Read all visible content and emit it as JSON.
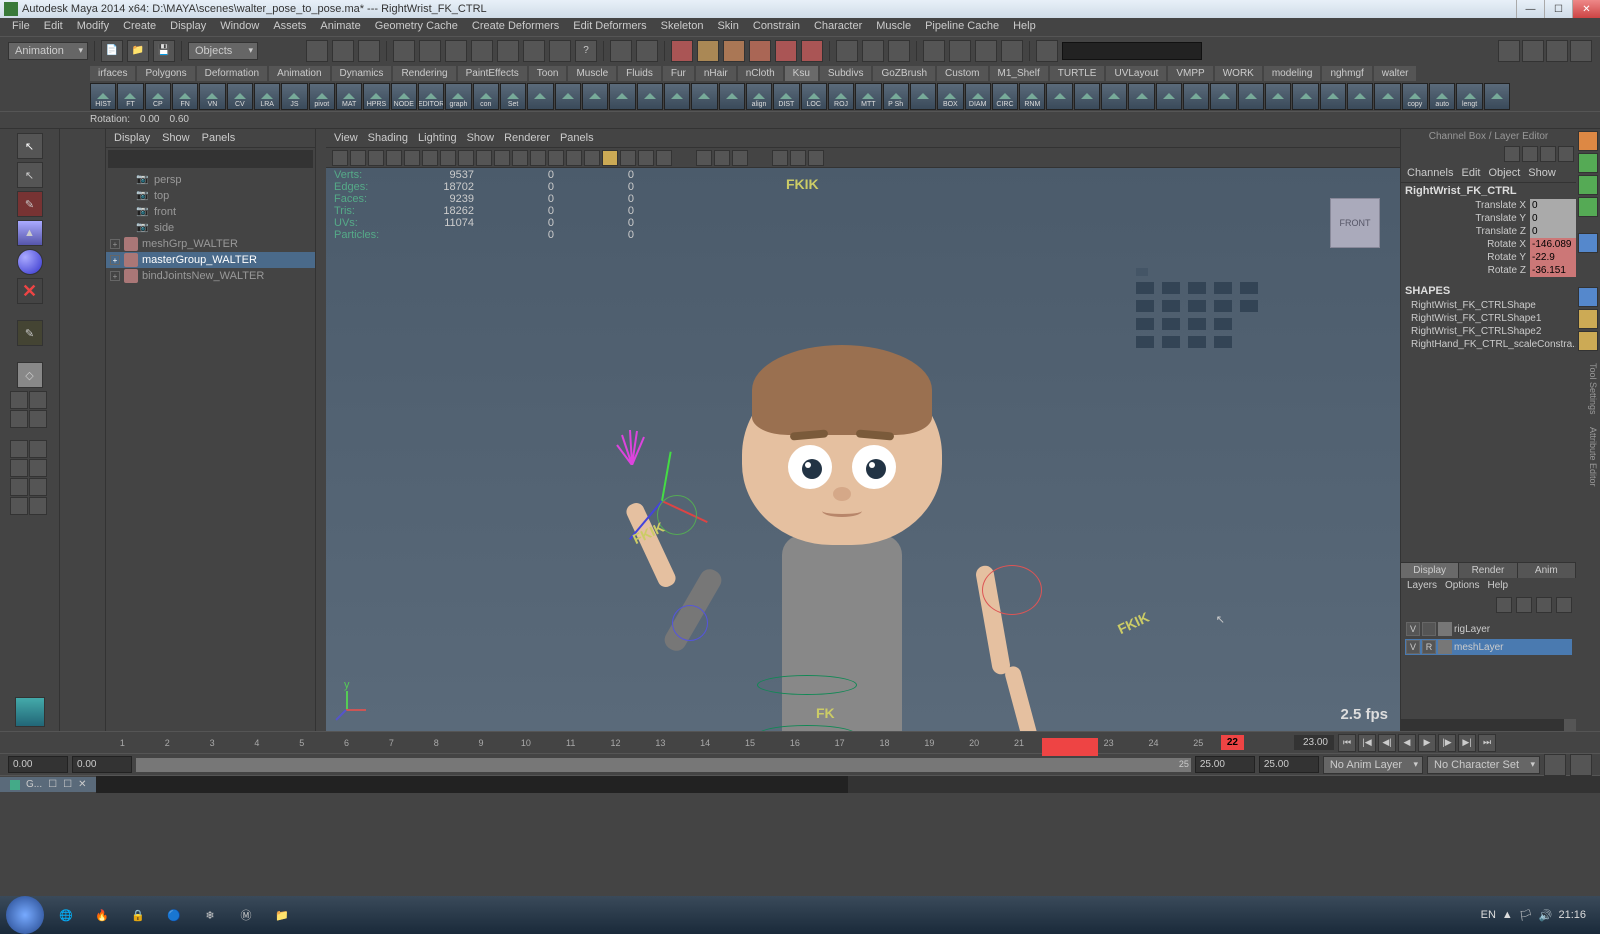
{
  "title": "Autodesk Maya 2014 x64: D:\\MAYA\\scenes\\walter_pose_to_pose.ma*  ---  RightWrist_FK_CTRL",
  "menubar": [
    "File",
    "Edit",
    "Modify",
    "Create",
    "Display",
    "Window",
    "Assets",
    "Animate",
    "Geometry Cache",
    "Create Deformers",
    "Edit Deformers",
    "Skeleton",
    "Skin",
    "Constrain",
    "Character",
    "Muscle",
    "Pipeline Cache",
    "Help"
  ],
  "mode_dropdown": "Animation",
  "objects_search": "Objects",
  "shelf_tabs": [
    "irfaces",
    "Polygons",
    "Deformation",
    "Animation",
    "Dynamics",
    "Rendering",
    "PaintEffects",
    "Toon",
    "Muscle",
    "Fluids",
    "Fur",
    "nHair",
    "nCloth",
    "Ksu",
    "Subdivs",
    "GoZBrush",
    "Custom",
    "M1_Shelf",
    "TURTLE",
    "UVLayout",
    "VMPP",
    "WORK",
    "modeling",
    "nghmgf",
    "walter"
  ],
  "shelf_active": "Ksu",
  "shelf_labels": [
    "HIST",
    "FT",
    "CP",
    "FN",
    "VN",
    "CV",
    "LRA",
    "JS",
    "pivot",
    "MAT",
    "HPRS",
    "NODE",
    "EDITOR",
    "graph",
    "con",
    "Set",
    "",
    "",
    "",
    "",
    "",
    "",
    "",
    "",
    "align",
    "DIST",
    "LOC",
    "ROJ",
    "MTT",
    "P Sh",
    "",
    "BOX",
    "DIAM",
    "CIRC",
    "RNM",
    "",
    "",
    "",
    "",
    "",
    "",
    "",
    "",
    "",
    "",
    "",
    "",
    "",
    "copy",
    "auto",
    "lengt",
    ""
  ],
  "status_line": {
    "label": "Rotation:",
    "v1": "0.00",
    "v2": "0.60"
  },
  "outliner": {
    "menu": [
      "Display",
      "Show",
      "Panels"
    ],
    "items": [
      {
        "type": "cam",
        "name": "persp"
      },
      {
        "type": "cam",
        "name": "top"
      },
      {
        "type": "cam",
        "name": "front"
      },
      {
        "type": "cam",
        "name": "side"
      },
      {
        "type": "grp",
        "name": "meshGrp_WALTER",
        "exp": true
      },
      {
        "type": "grp",
        "name": "masterGroup_WALTER",
        "exp": true,
        "sel": true
      },
      {
        "type": "grp",
        "name": "bindJointsNew_WALTER",
        "exp": true
      }
    ]
  },
  "viewport": {
    "menu": [
      "View",
      "Shading",
      "Lighting",
      "Show",
      "Renderer",
      "Panels"
    ],
    "stats": [
      {
        "label": "Verts:",
        "a": "9537",
        "b": "0",
        "c": "0"
      },
      {
        "label": "Edges:",
        "a": "18702",
        "b": "0",
        "c": "0"
      },
      {
        "label": "Faces:",
        "a": "9239",
        "b": "0",
        "c": "0"
      },
      {
        "label": "Tris:",
        "a": "18262",
        "b": "0",
        "c": "0"
      },
      {
        "label": "UVs:",
        "a": "11074",
        "b": "0",
        "c": "0"
      },
      {
        "label": "Particles:",
        "a": "",
        "b": "0",
        "c": "0"
      }
    ],
    "fps": "2.5 fps",
    "viewcube": "FRONT",
    "fk_label": "FK",
    "fkik_top": "FKIK",
    "fkik_right": "FKIK"
  },
  "channel_box": {
    "title": "Channel Box / Layer Editor",
    "menu": [
      "Channels",
      "Edit",
      "Object",
      "Show"
    ],
    "object": "RightWrist_FK_CTRL",
    "attrs": [
      {
        "name": "Translate X",
        "val": "0",
        "hl": "gray"
      },
      {
        "name": "Translate Y",
        "val": "0",
        "hl": "gray"
      },
      {
        "name": "Translate Z",
        "val": "0",
        "hl": "gray"
      },
      {
        "name": "Rotate X",
        "val": "-146.089",
        "hl": "red"
      },
      {
        "name": "Rotate Y",
        "val": "-22.9",
        "hl": "red"
      },
      {
        "name": "Rotate Z",
        "val": "-36.151",
        "hl": "red"
      }
    ],
    "shapes_header": "SHAPES",
    "shapes": [
      "RightWrist_FK_CTRLShape",
      "RightWrist_FK_CTRLShape1",
      "RightWrist_FK_CTRLShape2",
      "RightHand_FK_CTRL_scaleConstra..."
    ],
    "tabs": [
      "Display",
      "Render",
      "Anim"
    ],
    "tab_active": "Display",
    "submenu": [
      "Layers",
      "Options",
      "Help"
    ],
    "layers": [
      {
        "v": "V",
        "r": "",
        "name": "rigLayer",
        "sel": false
      },
      {
        "v": "V",
        "r": "R",
        "name": "meshLayer",
        "sel": true
      }
    ]
  },
  "timeline": {
    "ticks": [
      "1",
      "2",
      "3",
      "4",
      "5",
      "6",
      "7",
      "8",
      "9",
      "10",
      "11",
      "12",
      "13",
      "14",
      "15",
      "16",
      "17",
      "18",
      "19",
      "20",
      "21",
      "22",
      "23",
      "24",
      "25"
    ],
    "current": "22",
    "end": "23.00"
  },
  "range": {
    "start_outer": "0.00",
    "start_inner": "0.00",
    "start_frame": "0",
    "end_inner": "25",
    "end_outer": "25.00",
    "end_outer2": "25.00",
    "anim_layer": "No Anim Layer",
    "char_set": "No Character Set"
  },
  "cmd_tab": "G...",
  "vert_tab_tool": "Tool Settings",
  "vert_tab_attr": "Attribute Editor",
  "taskbar": {
    "lang": "EN",
    "time": "21:16"
  }
}
